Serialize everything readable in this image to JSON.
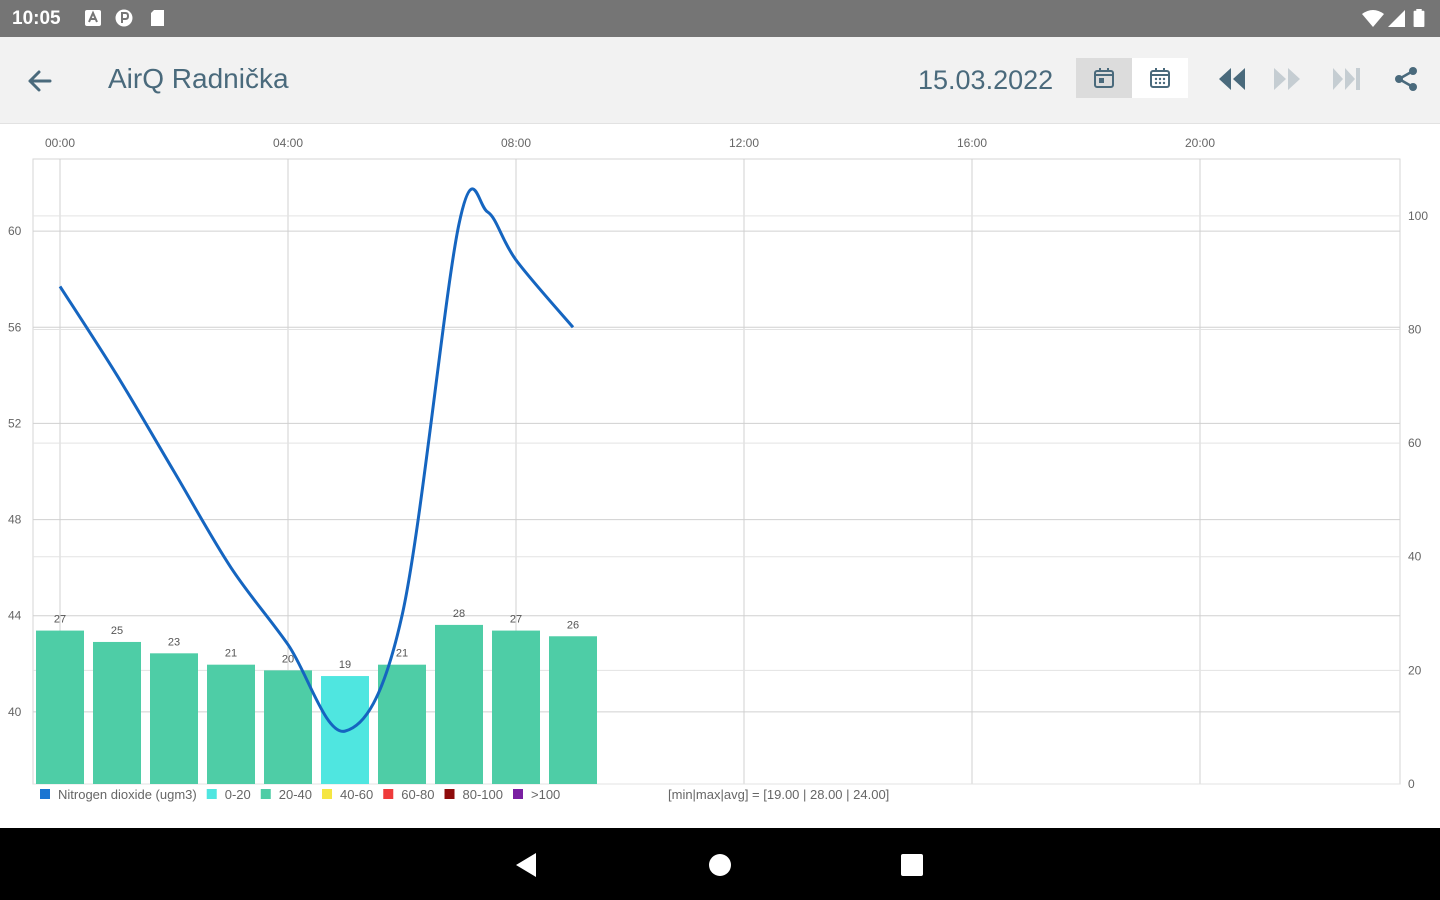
{
  "status_bar": {
    "time": "10:05",
    "left_icons": [
      "notification-a-icon",
      "notification-p-icon",
      "sd-card-icon"
    ],
    "right_icons": [
      "wifi-icon",
      "signal-icon",
      "battery-icon"
    ]
  },
  "app_bar": {
    "back_icon": "arrow-back-icon",
    "title": "AirQ Radnička",
    "date": "15.03.2022",
    "buttons": [
      "calendar-day-icon",
      "calendar-month-icon",
      "fast-rewind-icon",
      "fast-forward-icon",
      "skip-next-icon",
      "share-icon"
    ]
  },
  "colors": {
    "line": "#1565c0",
    "bar_20_40": "#4ecda6",
    "bar_0_20": "#4fe6e0",
    "accent_text": "#4a6a7c"
  },
  "chart_data": {
    "type": "bar+line",
    "x_ticks": [
      "00:00",
      "04:00",
      "08:00",
      "12:00",
      "16:00",
      "20:00"
    ],
    "left_axis_ticks": [
      "40",
      "44",
      "48",
      "52",
      "56",
      "60"
    ],
    "right_axis_ticks": [
      "0",
      "20",
      "40",
      "60",
      "80",
      "100"
    ],
    "left_ylim": [
      37,
      63
    ],
    "right_ylim": [
      0,
      110
    ],
    "bars": {
      "hours": [
        0,
        1,
        2,
        3,
        4,
        5,
        6,
        7,
        8,
        9
      ],
      "values": [
        27,
        25,
        23,
        21,
        20,
        19,
        21,
        28,
        27,
        26
      ],
      "bands": [
        "20-40",
        "20-40",
        "20-40",
        "20-40",
        "20-40",
        "0-20",
        "20-40",
        "20-40",
        "20-40",
        "20-40"
      ]
    },
    "line": {
      "hours": [
        0,
        1,
        2,
        3,
        4,
        5,
        6,
        7,
        7.5,
        8,
        9
      ],
      "values": [
        57.7,
        54,
        50,
        46,
        42.8,
        39.2,
        44,
        60.3,
        60.8,
        58.8,
        56.0
      ]
    },
    "legend": [
      {
        "label": "Nitrogen dioxide (ugm3)",
        "color": "#1a75d2"
      },
      {
        "label": "0-20",
        "color": "#4fe6e0"
      },
      {
        "label": "20-40",
        "color": "#4ecda6"
      },
      {
        "label": "40-60",
        "color": "#f5e642"
      },
      {
        "label": "60-80",
        "color": "#ef3b3b"
      },
      {
        "label": "80-100",
        "color": "#8e0b0b"
      },
      {
        "label": ">100",
        "color": "#7a1fa2"
      }
    ],
    "summary": "[min|max|avg] = [19.00 | 28.00 | 24.00]"
  }
}
